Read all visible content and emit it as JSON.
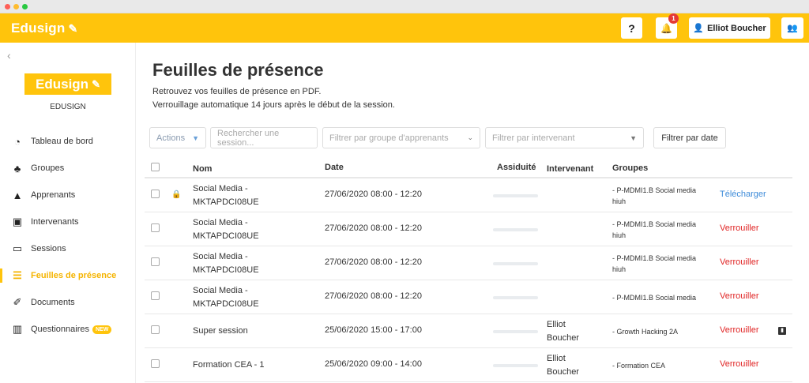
{
  "header": {
    "brand": "Edusign",
    "help_label": "?",
    "notification_count": "1",
    "user_name": "Elliot Boucher"
  },
  "sidebar": {
    "logo": "Edusign",
    "org_name": "EDUSIGN",
    "items": [
      {
        "label": "Tableau de bord",
        "icon": "dashboard-icon"
      },
      {
        "label": "Groupes",
        "icon": "groups-icon"
      },
      {
        "label": "Apprenants",
        "icon": "learners-icon"
      },
      {
        "label": "Intervenants",
        "icon": "teachers-icon"
      },
      {
        "label": "Sessions",
        "icon": "laptop-icon"
      },
      {
        "label": "Feuilles de présence",
        "icon": "list-icon",
        "active": true
      },
      {
        "label": "Documents",
        "icon": "documents-icon"
      },
      {
        "label": "Questionnaires",
        "icon": "chart-icon",
        "badge": "NEW"
      }
    ]
  },
  "page": {
    "title": "Feuilles de présence",
    "subtitle_1": "Retrouvez vos feuilles de présence en PDF.",
    "subtitle_2": "Verrouillage automatique 14 jours après le début de la session."
  },
  "filters": {
    "actions_label": "Actions",
    "search_placeholder": "Rechercher une session...",
    "group_placeholder": "Filtrer par groupe d'apprenants",
    "teacher_placeholder": "Filtrer par intervenant",
    "date_label": "Filtrer par date"
  },
  "table": {
    "columns": {
      "nom": "Nom",
      "date": "Date",
      "assiduite": "Assiduité",
      "intervenant": "Intervenant",
      "groupes": "Groupes"
    },
    "rows": [
      {
        "nom_1": "Social Media -",
        "nom_2": "MKTAPDCI08UE",
        "date": "27/06/2020 08:00 - 12:20",
        "int_1": "",
        "int_2": "",
        "grp_1": "- P-MDMI1.B Social media",
        "grp_2": "hiuh",
        "action": "Télécharger",
        "locked": true
      },
      {
        "nom_1": "Social Media -",
        "nom_2": "MKTAPDCI08UE",
        "date": "27/06/2020 08:00 - 12:20",
        "int_1": "",
        "int_2": "",
        "grp_1": "- P-MDMI1.B Social media",
        "grp_2": "hiuh",
        "action": "Verrouiller"
      },
      {
        "nom_1": "Social Media -",
        "nom_2": "MKTAPDCI08UE",
        "date": "27/06/2020 08:00 - 12:20",
        "int_1": "",
        "int_2": "",
        "grp_1": "- P-MDMI1.B Social media",
        "grp_2": "hiuh",
        "action": "Verrouiller"
      },
      {
        "nom_1": "Social Media -",
        "nom_2": "MKTAPDCI08UE",
        "date": "27/06/2020 08:00 - 12:20",
        "int_1": "",
        "int_2": "",
        "grp_1": "- P-MDMI1.B Social media",
        "grp_2": "",
        "action": "Verrouiller"
      },
      {
        "nom_1": "Super session",
        "nom_2": "",
        "date": "25/06/2020 15:00 - 17:00",
        "int_1": "Elliot",
        "int_2": "Boucher",
        "grp_1": "- Growth Hacking 2A",
        "grp_2": "",
        "action": "Verrouiller",
        "chart_icon": true
      },
      {
        "nom_1": "Formation CEA - 1",
        "nom_2": "",
        "date": "25/06/2020 09:00 - 14:00",
        "int_1": "Elliot",
        "int_2": "Boucher",
        "grp_1": "- Formation CEA",
        "grp_2": "",
        "action": "Verrouiller"
      }
    ]
  }
}
